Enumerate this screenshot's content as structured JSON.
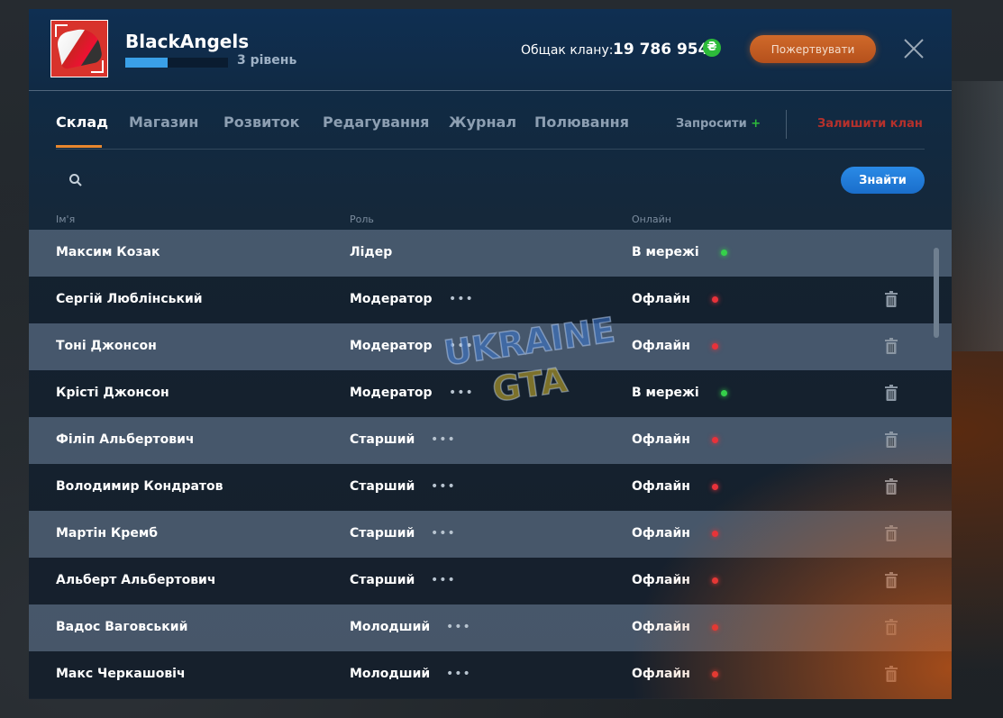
{
  "header": {
    "clan_name": "BlackAngels",
    "level_label": "3 рівень",
    "xp_fraction": 0.41,
    "treasury_label": "Общак клану:",
    "treasury_value": "19 786 954",
    "currency_symbol": "₴",
    "donate_label": "Пожертвувати"
  },
  "tabs": [
    {
      "label": "Склад",
      "active": true
    },
    {
      "label": "Магазин",
      "active": false
    },
    {
      "label": "Розвиток",
      "active": false
    },
    {
      "label": "Редагування",
      "active": false
    },
    {
      "label": "Журнал",
      "active": false
    },
    {
      "label": "Полювання",
      "active": false
    }
  ],
  "actions": {
    "invite_label": "Запросити",
    "invite_plus": "+",
    "leave_label": "Залишити клан"
  },
  "search": {
    "placeholder": "",
    "value": "",
    "button_label": "Знайти"
  },
  "table": {
    "headers": {
      "name": "Ім'я",
      "role": "Роль",
      "online": "Онлайн"
    },
    "rows": [
      {
        "name": "Максим Козак",
        "role": "Лідер",
        "status": "В мережі",
        "online": true,
        "has_menu": false,
        "has_delete": false
      },
      {
        "name": "Сергій Люблінський",
        "role": "Модератор",
        "status": "Офлайн",
        "online": false,
        "has_menu": true,
        "has_delete": true
      },
      {
        "name": "Тоні Джонсон",
        "role": "Модератор",
        "status": "Офлайн",
        "online": false,
        "has_menu": true,
        "has_delete": true
      },
      {
        "name": "Крісті Джонсон",
        "role": "Модератор",
        "status": "В мережі",
        "online": true,
        "has_menu": true,
        "has_delete": true
      },
      {
        "name": "Філіп Альбертович",
        "role": "Старший",
        "status": "Офлайн",
        "online": false,
        "has_menu": true,
        "has_delete": true
      },
      {
        "name": "Володимир Кондратов",
        "role": "Старший",
        "status": "Офлайн",
        "online": false,
        "has_menu": true,
        "has_delete": true
      },
      {
        "name": "Мартін Кремб",
        "role": "Старший",
        "status": "Офлайн",
        "online": false,
        "has_menu": true,
        "has_delete": true
      },
      {
        "name": "Альберт Альбертович",
        "role": "Старший",
        "status": "Офлайн",
        "online": false,
        "has_menu": true,
        "has_delete": true
      },
      {
        "name": "Вадос Ваговський",
        "role": "Молодший",
        "status": "Офлайн",
        "online": false,
        "has_menu": true,
        "has_delete": true
      },
      {
        "name": "Макс Черкашовіч",
        "role": "Молодший",
        "status": "Офлайн",
        "online": false,
        "has_menu": true,
        "has_delete": true
      }
    ]
  },
  "watermark": {
    "line1": "UKRAINE",
    "line2": "GTA"
  },
  "colors": {
    "accent_orange": "#e8872e",
    "button_blue": "#2a8ae6",
    "online_green": "#35d04a",
    "offline_red": "#e8323a",
    "leave_red": "#b5312c"
  }
}
